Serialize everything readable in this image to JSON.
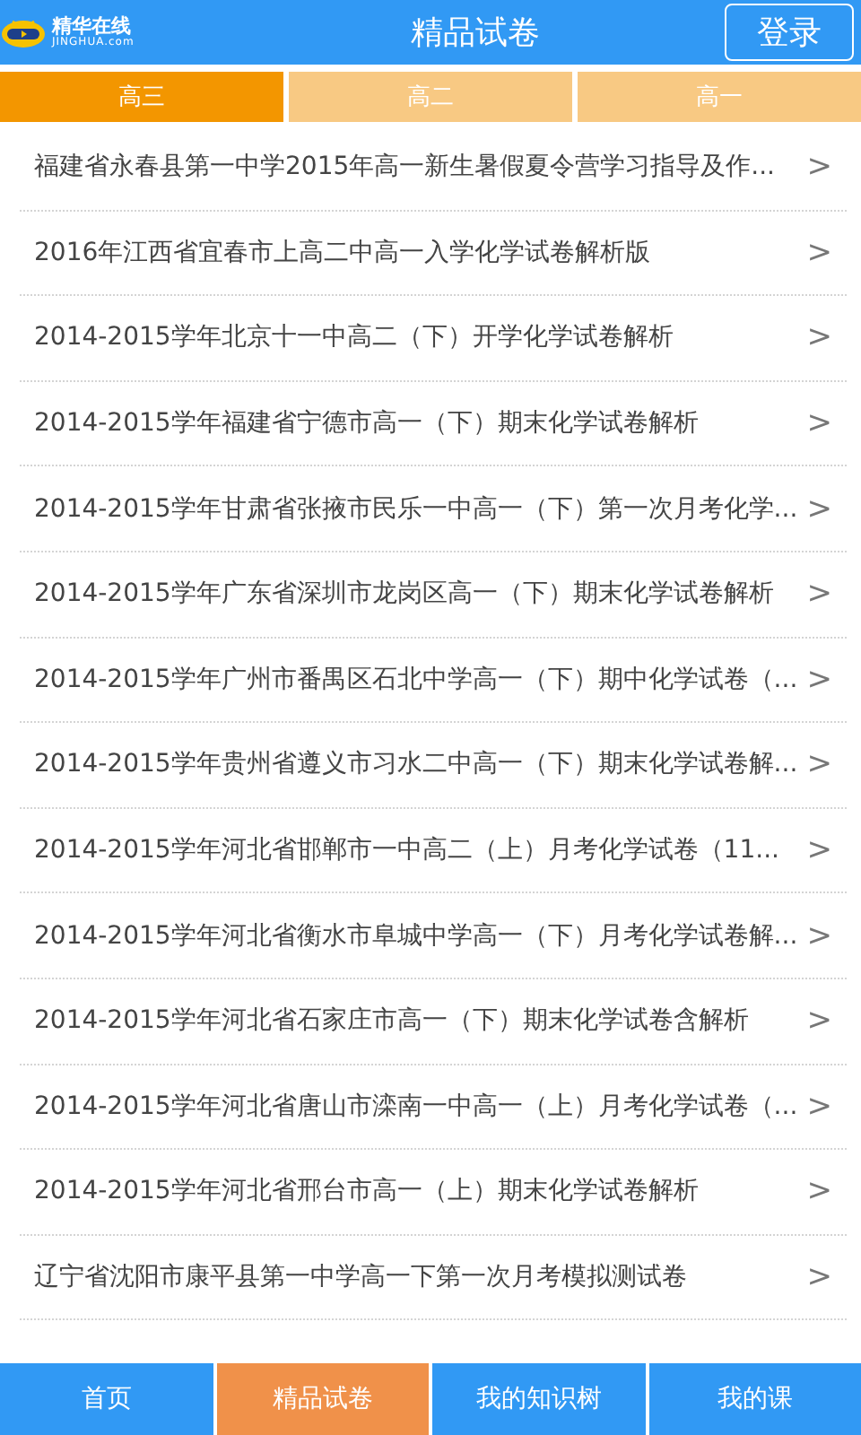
{
  "header": {
    "logo": {
      "name": "精华在线",
      "domain": "JINGHUA.com"
    },
    "title": "精品试卷",
    "login_button": "登录"
  },
  "tabs": [
    {
      "label": "高三",
      "selected": true
    },
    {
      "label": "高二",
      "selected": false
    },
    {
      "label": "高一",
      "selected": false
    }
  ],
  "papers": [
    {
      "title": "福建省永春县第一中学2015年高一新生暑假夏令营学习指导及作...",
      "arrow": ">"
    },
    {
      "title": "2016年江西省宜春市上高二中高一入学化学试卷解析版",
      "arrow": ">"
    },
    {
      "title": "2014-2015学年北京十一中高二（下）开学化学试卷解析",
      "arrow": ">"
    },
    {
      "title": "2014-2015学年福建省宁德市高一（下）期末化学试卷解析",
      "arrow": ">"
    },
    {
      "title": "2014-2015学年甘肃省张掖市民乐一中高一（下）第一次月考化学...",
      "arrow": ">"
    },
    {
      "title": "2014-2015学年广东省深圳市龙岗区高一（下）期末化学试卷解析",
      "arrow": ">"
    },
    {
      "title": "2014-2015学年广州市番禺区石北中学高一（下）期中化学试卷（...",
      "arrow": ">"
    },
    {
      "title": "2014-2015学年贵州省遵义市习水二中高一（下）期末化学试卷解...",
      "arrow": ">"
    },
    {
      "title": "2014-2015学年河北省邯郸市一中高二（上）月考化学试卷（11...",
      "arrow": ">"
    },
    {
      "title": "2014-2015学年河北省衡水市阜城中学高一（下）月考化学试卷解...",
      "arrow": ">"
    },
    {
      "title": "2014-2015学年河北省石家庄市高一（下）期末化学试卷含解析",
      "arrow": ">"
    },
    {
      "title": "2014-2015学年河北省唐山市滦南一中高一（上）月考化学试卷（...",
      "arrow": ">"
    },
    {
      "title": "2014-2015学年河北省邢台市高一（上）期末化学试卷解析",
      "arrow": ">"
    },
    {
      "title": "辽宁省沈阳市康平县第一中学高一下第一次月考模拟测试卷",
      "arrow": ">"
    }
  ],
  "bottom_nav": [
    {
      "label": "首页",
      "selected": false
    },
    {
      "label": "精品试卷",
      "selected": true
    },
    {
      "label": "我的知识树",
      "selected": false
    },
    {
      "label": "我的课",
      "selected": false
    }
  ]
}
